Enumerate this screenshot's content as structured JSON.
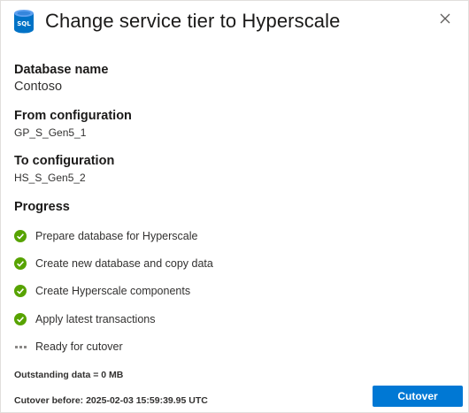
{
  "window": {
    "title": "Change service tier to Hyperscale",
    "icon_name": "sql-database-icon",
    "icon_text": "SQL",
    "close_icon": "close-icon"
  },
  "database": {
    "label": "Database name",
    "value": "Contoso"
  },
  "from": {
    "label": "From configuration",
    "value": "GP_S_Gen5_1"
  },
  "to": {
    "label": "To configuration",
    "value": "HS_S_Gen5_2"
  },
  "progress": {
    "label": "Progress",
    "steps": [
      {
        "label": "Prepare database for Hyperscale",
        "status": "complete",
        "icon": "check-circle-icon"
      },
      {
        "label": "Create new database and copy data",
        "status": "complete",
        "icon": "check-circle-icon"
      },
      {
        "label": "Create Hyperscale components",
        "status": "complete",
        "icon": "check-circle-icon"
      },
      {
        "label": "Apply latest transactions",
        "status": "complete",
        "icon": "check-circle-icon"
      },
      {
        "label": "Ready for cutover",
        "status": "in-progress",
        "icon": "progress-dots-icon"
      }
    ]
  },
  "outstanding": "Outstanding data = 0 MB",
  "cutover_before": "Cutover before: 2025-02-03 15:59:39.95 UTC",
  "actions": {
    "cutover_label": "Cutover"
  },
  "colors": {
    "accent": "#0078d4",
    "success": "#57a300",
    "text": "#323130"
  }
}
